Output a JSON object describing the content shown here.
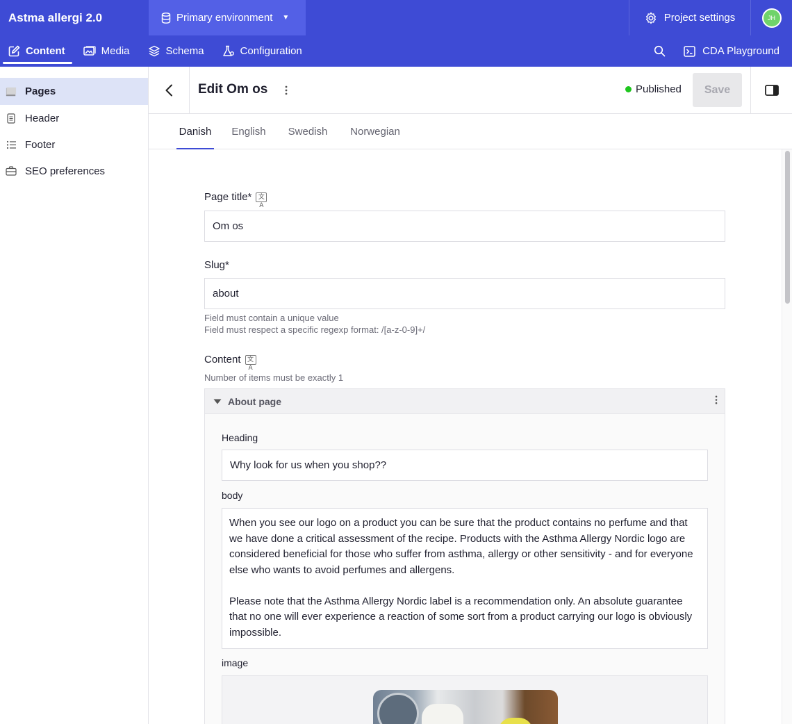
{
  "project": {
    "name": "Astma allergi 2.0"
  },
  "environment": {
    "label": "Primary environment"
  },
  "header_actions": {
    "project_settings": "Project settings",
    "avatar_initials": "JH"
  },
  "nav": {
    "tabs": [
      {
        "label": "Content",
        "icon": "pencil-square-icon",
        "active": true
      },
      {
        "label": "Media",
        "icon": "image-icon"
      },
      {
        "label": "Schema",
        "icon": "layers-icon"
      },
      {
        "label": "Configuration",
        "icon": "flask-gear-icon"
      }
    ],
    "cda_label": "CDA Playground"
  },
  "sidebar": {
    "items": [
      {
        "label": "Pages",
        "icon": "stack-icon",
        "active": true
      },
      {
        "label": "Header",
        "icon": "document-icon"
      },
      {
        "label": "Footer",
        "icon": "list-icon"
      },
      {
        "label": "SEO preferences",
        "icon": "briefcase-icon"
      }
    ]
  },
  "editor": {
    "title": "Edit Om os",
    "status": "Published",
    "save_label": "Save",
    "locales": [
      "Danish",
      "English",
      "Swedish",
      "Norwegian"
    ],
    "active_locale": "Danish"
  },
  "form": {
    "page_title": {
      "label": "Page title*",
      "value": "Om os"
    },
    "slug": {
      "label": "Slug*",
      "value": "about",
      "hints": [
        "Field must contain a unique value",
        "Field must respect a specific regexp format: /[a-z-0-9]+/"
      ]
    },
    "content": {
      "label": "Content",
      "hint": "Number of items must be exactly 1",
      "block": {
        "name": "About page",
        "heading_label": "Heading",
        "heading_value": "Why look for us when you shop??",
        "body_label": "body",
        "body_p1": "When you see our logo on a product you can be sure that the product contains no perfume and that we have done a critical assessment of the recipe. Products with the Asthma Allergy Nordic logo are considered beneficial for those who suffer from asthma, allergy or other sensitivity - and for everyone else who wants to avoid perfumes and allergens.",
        "body_p2": "Please note that the Asthma Allergy Nordic label is a recommendation only. An absolute guarantee that no one will ever experience a reaction of some sort from a product carrying our logo is obviously impossible.",
        "image_label": "image"
      }
    }
  },
  "colors": {
    "brand": "#3e4bd5",
    "environment_bg": "#5360e6",
    "published_dot": "#1ec61e",
    "sidebar_active_bg": "#dde3f7"
  }
}
